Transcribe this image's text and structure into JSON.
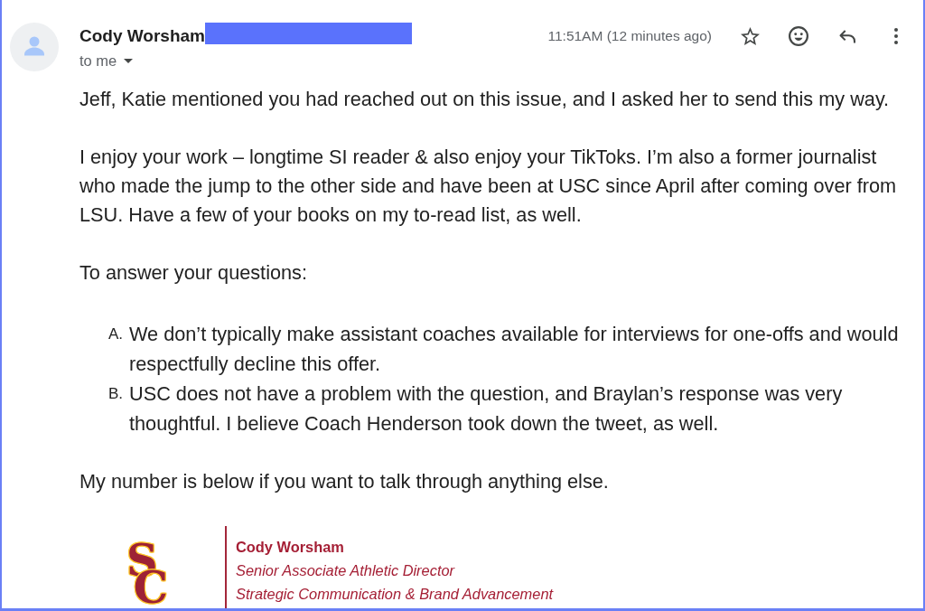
{
  "message_header": {
    "sender_name": "Cody Worsham",
    "sender_address_redacted": true,
    "recipient": "to me",
    "timestamp": "11:51AM (12 minutes ago)",
    "starred": false
  },
  "body": [
    {
      "kind": "paragraph",
      "text": "Jeff, Katie mentioned you had reached out on this issue, and I asked her to send this my way."
    },
    {
      "kind": "paragraph",
      "text": "I enjoy your work – longtime SI reader & also enjoy your TikToks. I’m also a former journalist who made the jump to the other side and have been at USC since April after coming over from LSU. Have a few of your books on my to-read list, as well."
    },
    {
      "kind": "paragraph",
      "text": "To answer your questions:"
    },
    {
      "kind": "list",
      "items": [
        {
          "marker": "A.",
          "text": "We don’t typically make assistant coaches available for interviews for one-offs and would respectfully decline this offer."
        },
        {
          "marker": "B.",
          "text": "USC does not have a problem with the question, and Braylan’s response was very thoughtful. I believe Coach Henderson took down the tweet, as well."
        }
      ]
    },
    {
      "kind": "paragraph",
      "text": "My number is below if you want to talk through anything else."
    }
  ],
  "signature": {
    "logo_letters": [
      "S",
      "C"
    ],
    "name": "Cody Worsham",
    "title": "Senior Associate Athletic Director",
    "department": "Strategic Communication & Brand Advancement"
  }
}
